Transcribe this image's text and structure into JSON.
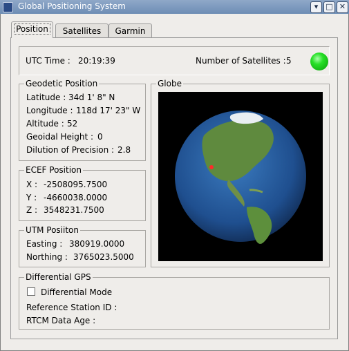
{
  "window": {
    "title": "Global Positioning System"
  },
  "tabs": [
    "Position",
    "Satellites",
    "Garmin"
  ],
  "status": {
    "utc_label": "UTC Time :",
    "utc_value": "20:19:39",
    "sat_label": "Number of Satellites :",
    "sat_value": "5",
    "led_color": "#22dd22"
  },
  "geodetic": {
    "title": "Geodetic Position",
    "latitude_label": "Latitude :",
    "latitude_value": "34d 1' 8\" N",
    "longitude_label": "Longitude :",
    "longitude_value": "118d 17' 23\" W",
    "altitude_label": "Altitude :",
    "altitude_value": "52",
    "geoidal_label": "Geoidal Height :",
    "geoidal_value": "0",
    "dop_label": "Dilution of Precision :",
    "dop_value": "2.8"
  },
  "ecef": {
    "title": "ECEF Position",
    "x_label": "X :",
    "x_value": "-2508095.7500",
    "y_label": "Y :",
    "y_value": "-4660038.0000",
    "z_label": "Z :",
    "z_value": "3548231.7500"
  },
  "utm": {
    "title": "UTM Posiiton",
    "easting_label": "Easting :",
    "easting_value": "380919.0000",
    "northing_label": "Northing :",
    "northing_value": "3765023.5000"
  },
  "globe": {
    "title": "Globe"
  },
  "dgps": {
    "title": "Differential GPS",
    "mode_label": "Differential Mode",
    "mode_checked": false,
    "ref_label": "Reference Station ID :",
    "rtcm_label": "RTCM Data Age :"
  }
}
